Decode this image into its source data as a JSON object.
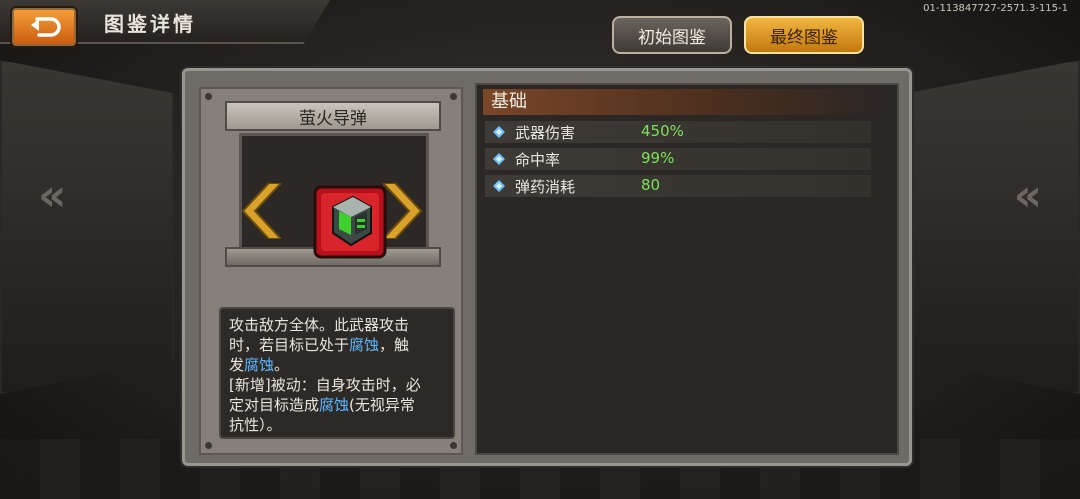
{
  "header": {
    "title": "图鉴详情",
    "version": "01-113847727-2571.3-115-1"
  },
  "tabs": {
    "initial_label": "初始图鉴",
    "final_label": "最终图鉴"
  },
  "item": {
    "name": "萤火导弹",
    "icon": "missile-crate-icon",
    "description": {
      "line1": "攻击敌方全体。此武器攻击",
      "line2a": "时，若目标已处于",
      "line2b": "腐蚀",
      "line2c": "，触",
      "line3a": "发",
      "line3b": "腐蚀",
      "line3c": "。",
      "line4": "[新增]被动：自身攻击时，必",
      "line5a": "定对目标造成",
      "line5b": "腐蚀",
      "line5c": "(无视异常",
      "line6": "抗性）。"
    }
  },
  "stats": {
    "section_title": "基础",
    "rows": [
      {
        "label": "武器伤害",
        "value": "450%"
      },
      {
        "label": "命中率",
        "value": "99%"
      },
      {
        "label": "弹药消耗",
        "value": "80"
      }
    ]
  },
  "colors": {
    "accent_orange": "#f2b640",
    "stat_value_green": "#7be35a",
    "highlight_blue": "#5fb6ff"
  }
}
